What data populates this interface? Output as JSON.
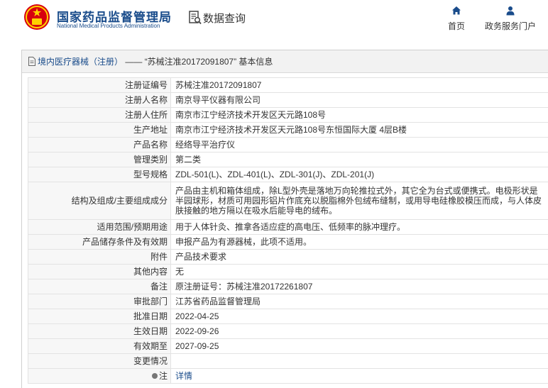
{
  "header": {
    "org_cn": "国家药品监督管理局",
    "org_en": "National Medical Products Administration",
    "section_title": "数据查询",
    "nav": [
      {
        "label": "首页",
        "icon": "home-icon"
      },
      {
        "label": "政务服务门户",
        "icon": "user-icon"
      }
    ]
  },
  "panel": {
    "breadcrumb_category": "境内医疗器械（注册）",
    "breadcrumb_sep": " —— ",
    "breadcrumb_record": "“苏械注准20172091807”",
    "breadcrumb_suffix": " 基本信息"
  },
  "rows": [
    {
      "label": "注册证编号",
      "value": "苏械注准20172091807"
    },
    {
      "label": "注册人名称",
      "value": "南京导平仪器有限公司"
    },
    {
      "label": "注册人住所",
      "value": "南京市江宁经济技术开发区天元路108号"
    },
    {
      "label": "生产地址",
      "value": "南京市江宁经济技术开发区天元路108号东恒国际大厦 4层B楼"
    },
    {
      "label": "产品名称",
      "value": "经络导平治疗仪"
    },
    {
      "label": "管理类别",
      "value": "第二类"
    },
    {
      "label": "型号规格",
      "value": "ZDL-501(L)、ZDL-401(L)、ZDL-301(J)、ZDL-201(J)"
    },
    {
      "label": "结构及组成/主要组成成分",
      "value": "产品由主机和箱体组成，除L型外壳是落地万向轮推拉式外，其它全为台式或便携式。电极形状是半园球形，材质可用园形铝片作底充以脱脂棉外包绒布缝制，或用导电硅橡胶模压而成，与人体皮肤接触的地方隔以在吸水后能导电的绒布。"
    },
    {
      "label": "适用范围/预期用途",
      "value": "用于人体针灸、推拿各适应症的高电压、低频率的脉冲理疗。"
    },
    {
      "label": "产品储存条件及有效期",
      "value": "申报产品为有源器械，此项不适用。"
    },
    {
      "label": "附件",
      "value": "产品技术要求"
    },
    {
      "label": "其他内容",
      "value": "无"
    },
    {
      "label": "备注",
      "value": "原注册证号：苏械注准20172261807"
    },
    {
      "label": "审批部门",
      "value": "江苏省药品监督管理局"
    },
    {
      "label": "批准日期",
      "value": "2022-04-25"
    },
    {
      "label": "生效日期",
      "value": "2022-09-26"
    },
    {
      "label": "有效期至",
      "value": "2027-09-25"
    },
    {
      "label": "变更情况",
      "value": ""
    },
    {
      "label": "注",
      "value": "详情"
    }
  ]
}
